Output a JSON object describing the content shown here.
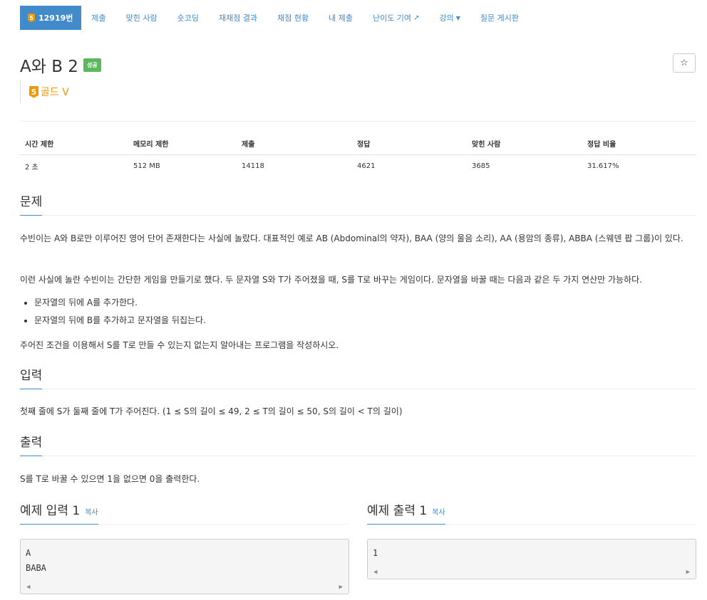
{
  "nav": {
    "problem_tab": "12919번",
    "tier_number": "5",
    "items": [
      "제출",
      "맞힌 사람",
      "숏코딩",
      "재채점 결과",
      "채점 현황",
      "내 제출",
      "난이도 기여",
      "강의",
      "질문 게시판"
    ]
  },
  "problem": {
    "title": "A와 B 2",
    "status": "성공",
    "tier_number": "5",
    "tier": "골드 V",
    "star": "☆"
  },
  "stats": {
    "headers": [
      "시간 제한",
      "메모리 제한",
      "제출",
      "정답",
      "맞힌 사람",
      "정답 비율"
    ],
    "values": [
      "2 초",
      "512 MB",
      "14118",
      "4621",
      "3685",
      "31.617%"
    ]
  },
  "sections": {
    "problem_heading": "문제",
    "problem_p1": "수빈이는 A와 B로만 이루어진 영어 단어 존재한다는 사실에 놀랐다. 대표적인 예로 AB (Abdominal의 약자), BAA (양의 울음 소리), AA (용암의 종류), ABBA (스웨덴 팝 그룹)이 있다.",
    "problem_p2": "이런 사실에 놀란 수빈이는 간단한 게임을 만들기로 했다. 두 문자열 S와 T가 주어졌을 때, S를 T로 바꾸는 게임이다. 문자열을 바꿀 때는 다음과 같은 두 가지 연산만 가능하다.",
    "problem_list": [
      "문자열의 뒤에 A를 추가한다.",
      "문자열의 뒤에 B를 추가하고 문자열을 뒤집는다."
    ],
    "problem_p3": "주어진 조건을 이용해서 S를 T로 만들 수 있는지 없는지 알아내는 프로그램을 작성하시오.",
    "input_heading": "입력",
    "input_text": "첫째 줄에 S가 둘째 줄에 T가 주어진다. (1 ≤ S의 길이 ≤ 49, 2 ≤ T의 길이 ≤ 50, S의 길이 < T의 길이)",
    "output_heading": "출력",
    "output_text": "S를 T로 바꿀 수 있으면 1을 없으면 0을 출력한다."
  },
  "samples": {
    "input_heading": "예제 입력 1",
    "output_heading": "예제 출력 1",
    "copy_label": "복사",
    "input_text": "A\nBABA",
    "output_text": "1"
  }
}
